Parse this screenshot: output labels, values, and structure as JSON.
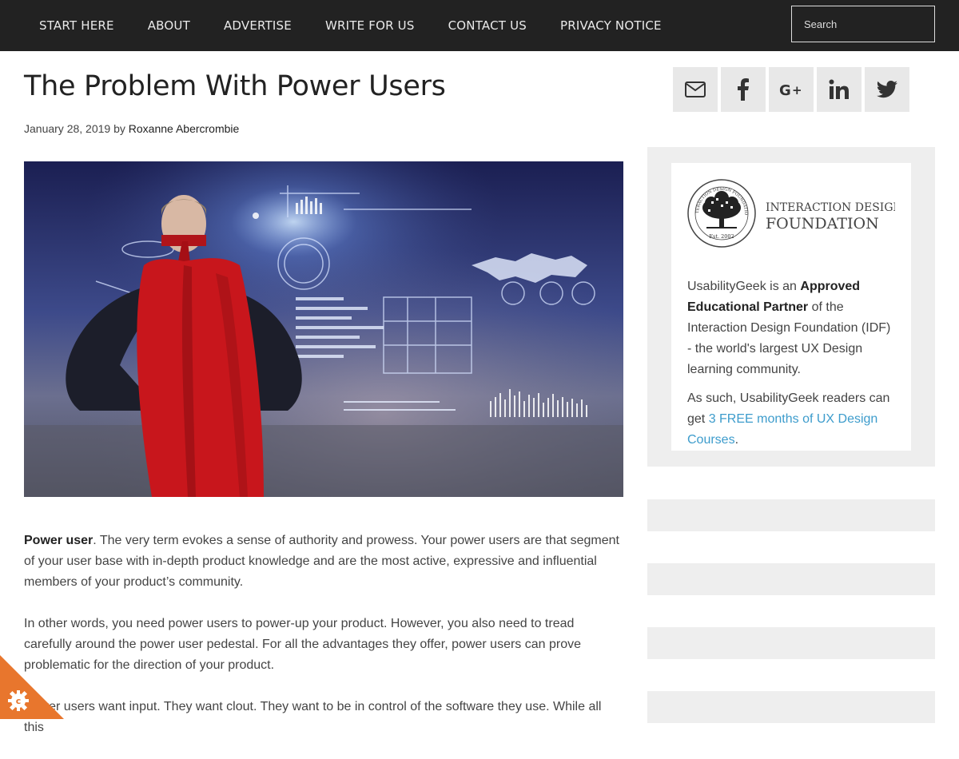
{
  "nav": {
    "items": [
      "START HERE",
      "ABOUT",
      "ADVERTISE",
      "WRITE FOR US",
      "CONTACT US",
      "PRIVACY NOTICE"
    ],
    "search_placeholder": "Search"
  },
  "post": {
    "title": "The Problem With Power Users",
    "date": "January 28, 2019",
    "by": "by",
    "author": "Roxanne Abercrombie",
    "p1_bold": "Power user",
    "p1_rest": ". The very term evokes a sense of authority and prowess. Your power users are that segment of your user base with in-depth product knowledge and are the most active, expressive and influential members of your product’s community.",
    "p2": "In other words, you need power users to power-up your product. However, you also need to tread carefully around the power user pedestal. For all the advantages they offer, power users can prove problematic for the direction of your product.",
    "p3": "Power users want input. They want clout. They want to be in control of the software they use. While all this"
  },
  "social": {
    "icons": [
      "email-icon",
      "facebook-icon",
      "google-plus-icon",
      "linkedin-icon",
      "twitter-icon"
    ]
  },
  "idf": {
    "logo_line1": "INTERACTION DESIGN",
    "logo_line2": "FOUNDATION",
    "seal_ring_text": "INTERACTION DESIGN FOUNDATION",
    "seal_est": "Est. 2002",
    "t1": "UsabilityGeek is an ",
    "t1_bold": "Approved Educational Partner",
    "t1_rest": " of the Interaction Design Foundation (IDF) - the world's largest UX Design learning community.",
    "t2": "As such, UsabilityGeek readers can get ",
    "t2_link": "3 FREE months of UX Design Courses",
    "t2_end": "."
  },
  "colors": {
    "nav_bg": "#222222",
    "link": "#3d9ccc",
    "cookie": "#e8762d",
    "cape": "#c8161c"
  }
}
